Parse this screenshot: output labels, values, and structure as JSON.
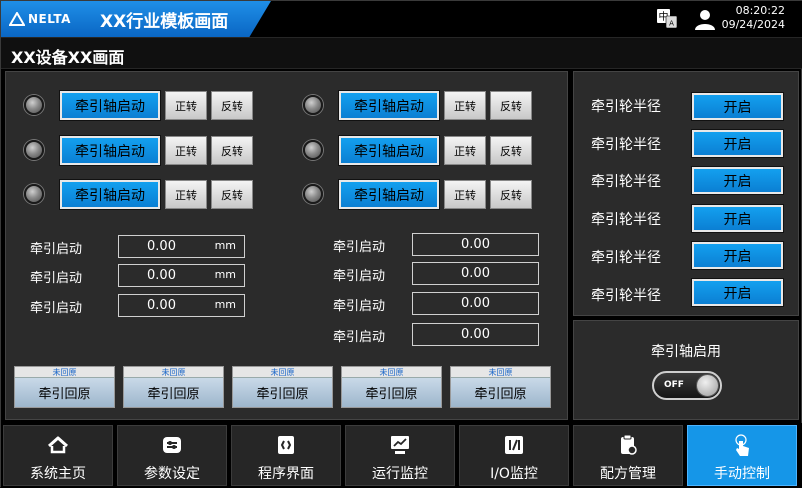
{
  "header": {
    "brand": "NELTA",
    "title": "XX行业模板画面",
    "time": "08:20:22",
    "date": "09/24/2024",
    "icons": [
      "language-icon",
      "user-icon"
    ]
  },
  "page": {
    "title": "XX设备XX画面"
  },
  "axes_left": [
    {
      "start": "牵引轴启动",
      "fwd": "正转",
      "rev": "反转"
    },
    {
      "start": "牵引轴启动",
      "fwd": "正转",
      "rev": "反转"
    },
    {
      "start": "牵引轴启动",
      "fwd": "正转",
      "rev": "反转"
    }
  ],
  "axes_right": [
    {
      "start": "牵引轴启动",
      "fwd": "正转",
      "rev": "反转"
    },
    {
      "start": "牵引轴启动",
      "fwd": "正转",
      "rev": "反转"
    },
    {
      "start": "牵引轴启动",
      "fwd": "正转",
      "rev": "反转"
    }
  ],
  "fields_left": [
    {
      "label": "牵引启动",
      "value": "0.00",
      "unit": "mm"
    },
    {
      "label": "牵引启动",
      "value": "0.00",
      "unit": "mm"
    },
    {
      "label": "牵引启动",
      "value": "0.00",
      "unit": "mm"
    }
  ],
  "fields_right": [
    {
      "label": "牵引启动",
      "value": "0.00"
    },
    {
      "label": "牵引启动",
      "value": "0.00"
    },
    {
      "label": "牵引启动",
      "value": "0.00"
    },
    {
      "label": "牵引启动",
      "value": "0.00"
    }
  ],
  "homing": [
    {
      "status": "未回原",
      "label": "牵引回原"
    },
    {
      "status": "未回原",
      "label": "牵引回原"
    },
    {
      "status": "未回原",
      "label": "牵引回原"
    },
    {
      "status": "未回原",
      "label": "牵引回原"
    },
    {
      "status": "未回原",
      "label": "牵引回原"
    }
  ],
  "wheels": [
    {
      "label": "牵引轮半径",
      "button": "开启"
    },
    {
      "label": "牵引轮半径",
      "button": "开启"
    },
    {
      "label": "牵引轮半径",
      "button": "开启"
    },
    {
      "label": "牵引轮半径",
      "button": "开启"
    },
    {
      "label": "牵引轮半径",
      "button": "开启"
    },
    {
      "label": "牵引轮半径",
      "button": "开启"
    }
  ],
  "enable": {
    "title": "牵引轴启用",
    "toggle": "OFF"
  },
  "nav": [
    {
      "label": "系统主页",
      "icon": "home-icon",
      "active": false
    },
    {
      "label": "参数设定",
      "icon": "settings-icon",
      "active": false
    },
    {
      "label": "程序界面",
      "icon": "code-icon",
      "active": false
    },
    {
      "label": "运行监控",
      "icon": "monitor-icon",
      "active": false
    },
    {
      "label": "I/O监控",
      "icon": "io-icon",
      "active": false
    },
    {
      "label": "配方管理",
      "icon": "recipe-icon",
      "active": false
    },
    {
      "label": "手动控制",
      "icon": "hand-touch-icon",
      "active": true
    }
  ],
  "colors": {
    "accent": "#1596e8",
    "panel": "#2b2b2b",
    "home_status": "#1463c8"
  }
}
